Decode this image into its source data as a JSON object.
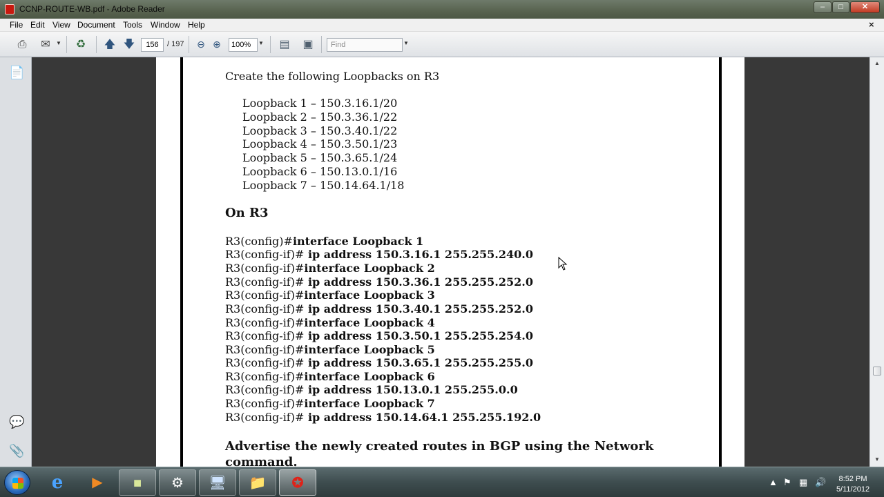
{
  "window": {
    "title": "CCNP-ROUTE-WB.pdf - Adobe Reader",
    "min_label": "–",
    "max_label": "□",
    "close_label": "✕"
  },
  "menu": {
    "items": [
      "File",
      "Edit",
      "View",
      "Document",
      "Tools",
      "Window",
      "Help"
    ],
    "doc_close_label": "×"
  },
  "toolbar": {
    "current_page": "156",
    "total_pages": "/ 197",
    "zoom": "100%",
    "find_placeholder": "Find"
  },
  "document": {
    "intro": "Create the following Loopbacks on R3",
    "loopbacks": [
      "Loopback 1 – 150.3.16.1/20",
      "Loopback 2 – 150.3.36.1/22",
      "Loopback 3 – 150.3.40.1/22",
      "Loopback 4 – 150.3.50.1/23",
      "Loopback 5 – 150.3.65.1/24",
      "Loopback 6 – 150.13.0.1/16",
      "Loopback 7 – 150.14.64.1/18"
    ],
    "heading_r3": "On R3",
    "config": [
      {
        "prompt": "R3(config)#",
        "cmd": "interface Loopback 1"
      },
      {
        "prompt": "R3(config-if)#",
        "cmd": " ip address 150.3.16.1 255.255.240.0"
      },
      {
        "prompt": "R3(config-if)#",
        "cmd": "interface Loopback 2"
      },
      {
        "prompt": "R3(config-if)#",
        "cmd": " ip address 150.3.36.1 255.255.252.0"
      },
      {
        "prompt": "R3(config-if)#",
        "cmd": "interface Loopback 3"
      },
      {
        "prompt": "R3(config-if)#",
        "cmd": " ip address 150.3.40.1 255.255.252.0"
      },
      {
        "prompt": "R3(config-if)#",
        "cmd": "interface Loopback 4"
      },
      {
        "prompt": "R3(config-if)#",
        "cmd": " ip address 150.3.50.1 255.255.254.0"
      },
      {
        "prompt": "R3(config-if)#",
        "cmd": "interface Loopback 5"
      },
      {
        "prompt": "R3(config-if)#",
        "cmd": " ip address 150.3.65.1 255.255.255.0"
      },
      {
        "prompt": "R3(config-if)#",
        "cmd": "interface Loopback 6"
      },
      {
        "prompt": "R3(config-if)#",
        "cmd": " ip address 150.13.0.1 255.255.0.0"
      },
      {
        "prompt": "R3(config-if)#",
        "cmd": "interface Loopback 7"
      },
      {
        "prompt": "R3(config-if)#",
        "cmd": " ip address 150.14.64.1 255.255.192.0"
      }
    ],
    "heading_bgp_1": "Advertise the newly created routes in BGP using the Network",
    "heading_bgp_2": "command."
  },
  "taskbar": {
    "time": "8:52 PM",
    "date": "5/11/2012"
  },
  "icons": {
    "print": "print-icon",
    "page_up": "arrow-up-icon",
    "page_down": "arrow-down-icon",
    "zoom_out": "zoom-out-icon",
    "zoom_in": "zoom-in-icon"
  }
}
